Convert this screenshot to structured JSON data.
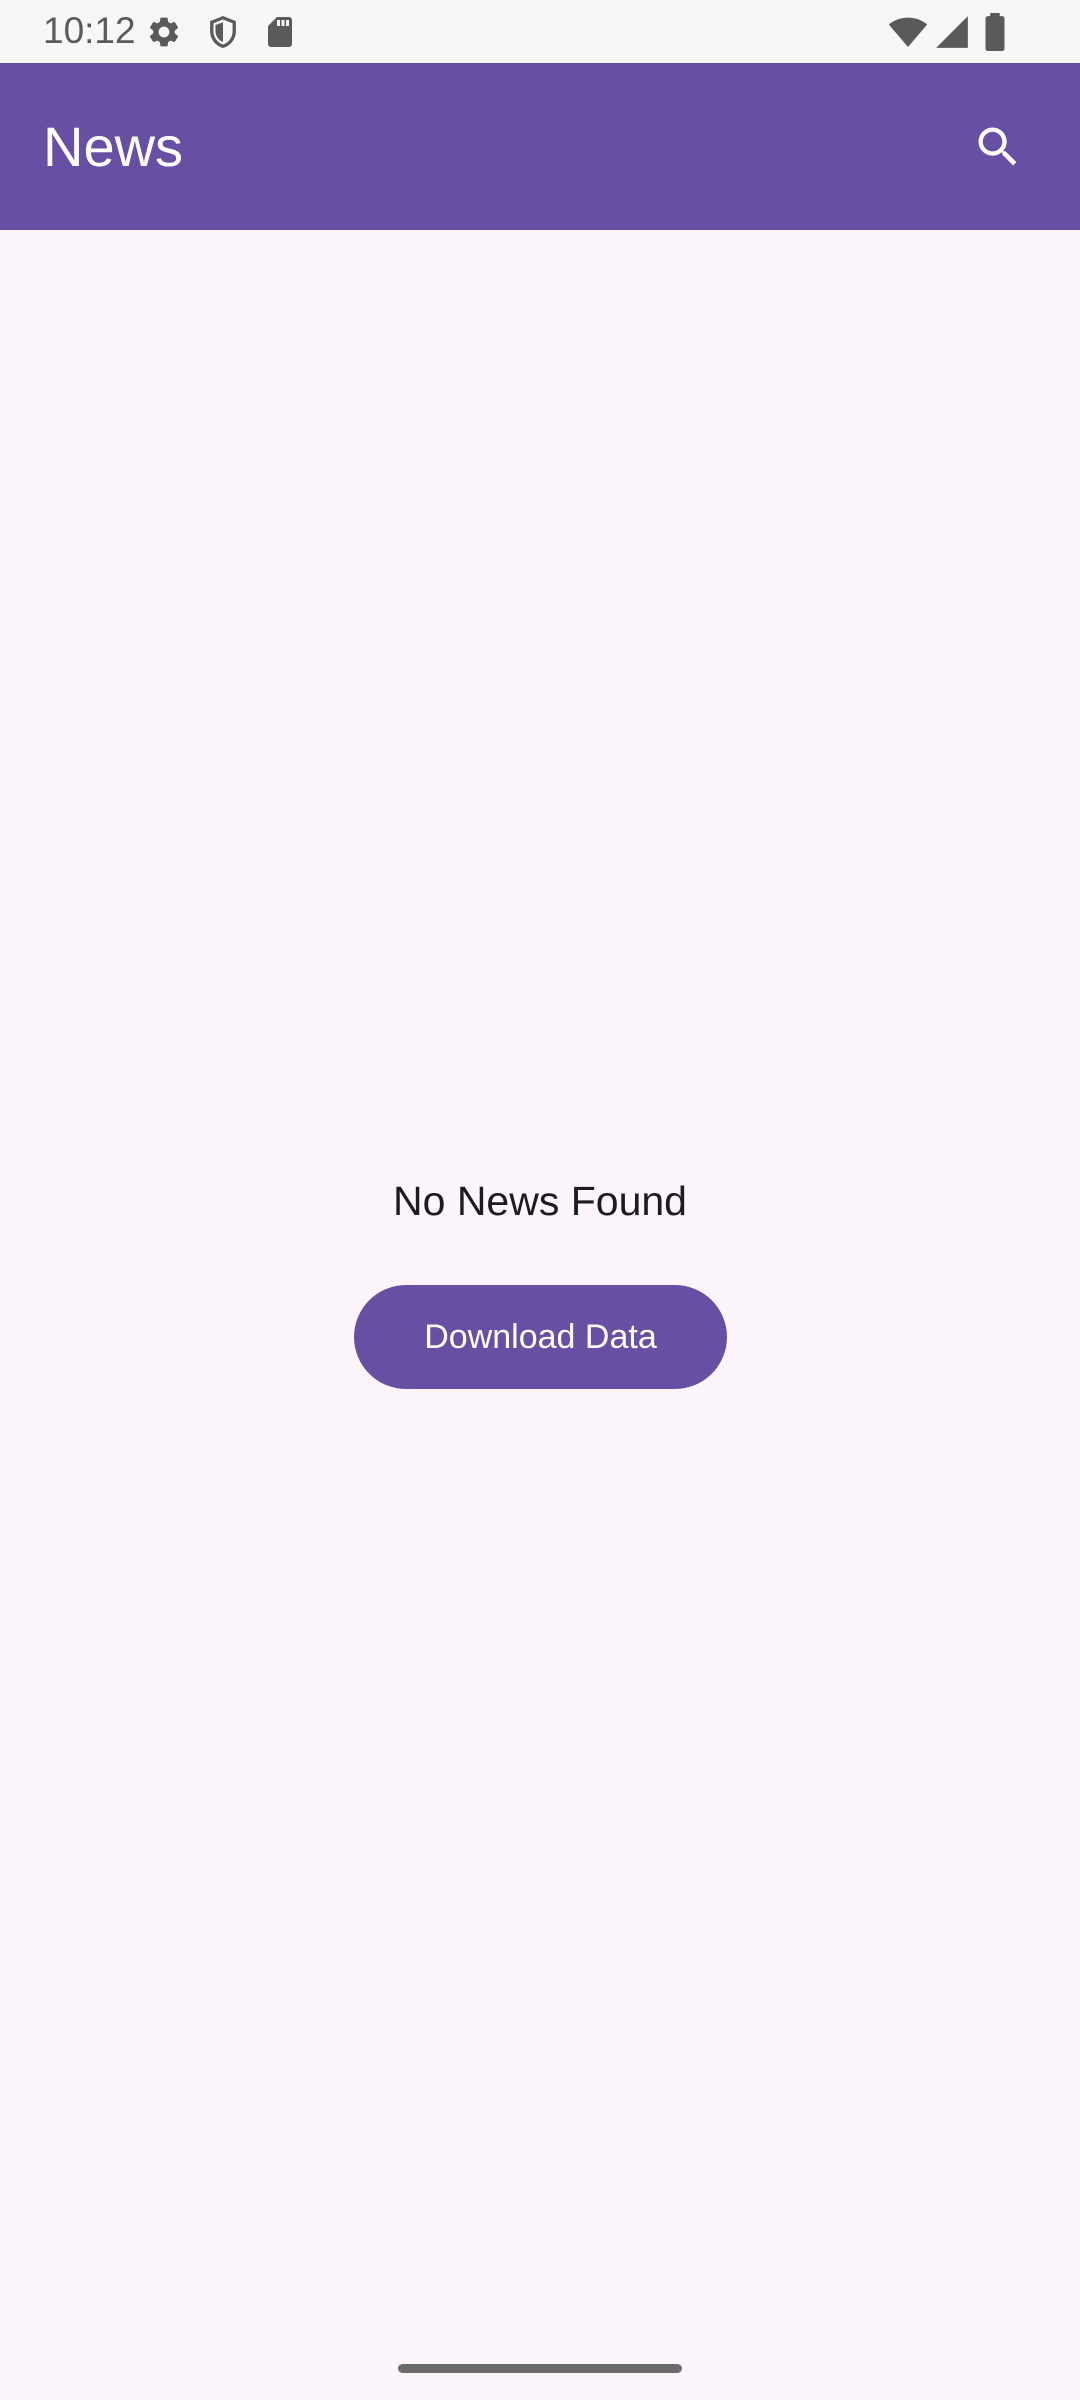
{
  "status_bar": {
    "time": "10:12",
    "left_icons": [
      "gear-icon",
      "shield-icon",
      "sd-card-icon"
    ],
    "right_icons": [
      "wifi-icon",
      "signal-icon",
      "battery-icon"
    ]
  },
  "app_bar": {
    "title": "News",
    "action_icon": "search-icon",
    "color": "#6750a4"
  },
  "main": {
    "empty_message": "No News Found",
    "download_button_label": "Download Data"
  },
  "colors": {
    "accent": "#6750a4",
    "background": "#fcf6fc"
  }
}
